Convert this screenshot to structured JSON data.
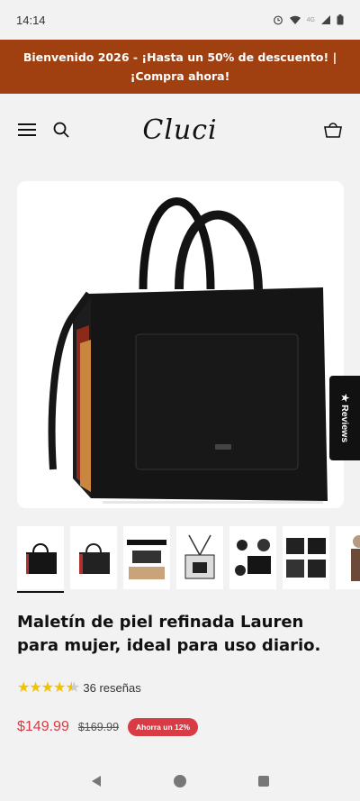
{
  "status_bar": {
    "time": "14:14",
    "icons": [
      "alarm-icon",
      "wifi-icon",
      "4g-icon",
      "signal-icon",
      "battery-icon"
    ],
    "network": "4G"
  },
  "banner": {
    "text": "Bienvenido 2026 - ¡Hasta un 50% de descuento! | ¡Compra ahora!",
    "bg_color": "#a04010"
  },
  "header": {
    "logo": "Cluci",
    "icons": [
      "menu-icon",
      "search-icon",
      "bag-icon"
    ]
  },
  "product_gallery": {
    "reviews_tab": "★ Reviews",
    "thumbnail_count": 7
  },
  "product": {
    "title": "Maletín de piel refinada Lauren para mujer, ideal para uso diario.",
    "rating": 4.5,
    "reviews": "36 reseñas",
    "price": "$149.99",
    "old_price": "$169.99",
    "badge": "Ahorra un 12%",
    "accent_color": "#d93b45"
  },
  "nav_bar": {
    "icons": [
      "back-icon",
      "home-icon",
      "recents-icon"
    ]
  }
}
